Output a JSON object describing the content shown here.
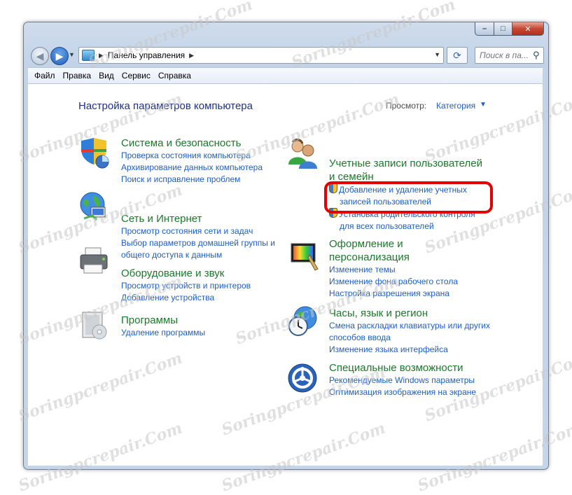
{
  "window": {
    "minimize": "–",
    "maximize": "□",
    "close": "✕"
  },
  "nav": {
    "address_path": "Панель управления",
    "search_placeholder": "Поиск в па...",
    "back_icon": "arrow-left-icon",
    "forward_icon": "arrow-right-icon",
    "refresh_icon": "refresh-icon",
    "search_icon": "magnifier-icon"
  },
  "menu": [
    "Файл",
    "Правка",
    "Вид",
    "Сервис",
    "Справка"
  ],
  "content": {
    "title": "Настройка параметров компьютера",
    "view_label": "Просмотр:",
    "view_value": "Категория"
  },
  "categories_left": [
    {
      "title": "Система и безопасность",
      "icon": "shield-system-icon",
      "links": [
        "Проверка состояния компьютера",
        "Архивирование данных компьютера",
        "Поиск и исправление проблем"
      ]
    },
    {
      "title": "Сеть и Интернет",
      "icon": "network-globe-icon",
      "links": [
        "Просмотр состояния сети и задач",
        "Выбор параметров домашней группы и",
        "общего доступа к данным"
      ]
    },
    {
      "title": "Оборудование и звук",
      "icon": "printer-icon",
      "links": [
        "Просмотр устройств и принтеров",
        "Добавление устройства"
      ]
    },
    {
      "title": "Программы",
      "icon": "programs-icon",
      "links": [
        "Удаление программы"
      ]
    }
  ],
  "categories_right": [
    {
      "title_line1": "Учетные записи пользователей",
      "title_line2": "и семейн",
      "icon": "users-icon",
      "link1_line1": "Добавление и удаление учетных",
      "link1_line2": "записей пользователей",
      "link2_line1": "Установка родительского контроля",
      "link2_line2": "для всех пользователей"
    },
    {
      "title_line1": "Оформление и",
      "title_line2": "персонализация",
      "icon": "display-personalization-icon",
      "links": [
        "Изменение темы",
        "Изменение фона рабочего стола",
        "Настройка разрешения экрана"
      ]
    },
    {
      "title": "Часы, язык и регион",
      "icon": "clock-globe-icon",
      "links": [
        "Смена раскладки клавиатуры или других",
        "способов ввода",
        "Изменение языка интерфейса"
      ]
    },
    {
      "title": "Специальные возможности",
      "icon": "accessibility-icon",
      "links": [
        "Рекомендуемые Windows параметры",
        "Оптимизация изображения на экране"
      ]
    }
  ],
  "watermark": "Soringpcrepair.Com",
  "colors": {
    "link": "#1e5ec8",
    "category_title": "#1a7a29",
    "highlight": "#e50000"
  }
}
